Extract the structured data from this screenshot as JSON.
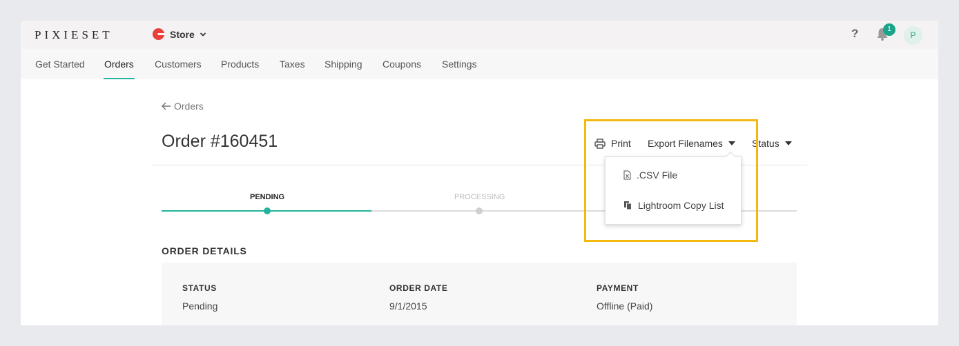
{
  "header": {
    "logo": "PIXIESET",
    "store_label": "Store",
    "help_label": "?",
    "notification_count": "1",
    "avatar_initial": "P",
    "brand_color": "#e8413c",
    "accent_color": "#2ab59a"
  },
  "nav": {
    "tabs": [
      {
        "label": "Get Started"
      },
      {
        "label": "Orders",
        "active": true
      },
      {
        "label": "Customers"
      },
      {
        "label": "Products"
      },
      {
        "label": "Taxes"
      },
      {
        "label": "Shipping"
      },
      {
        "label": "Coupons"
      },
      {
        "label": "Settings"
      }
    ]
  },
  "page": {
    "back_label": "Orders",
    "title": "Order #160451",
    "actions": {
      "print": "Print",
      "export": "Export Filenames",
      "status": "Status"
    },
    "export_menu": [
      {
        "label": ".CSV File",
        "icon": "csv-file-icon"
      },
      {
        "label": "Lightroom Copy List",
        "icon": "copy-list-icon"
      }
    ],
    "steps": [
      {
        "label": "PENDING",
        "state": "active"
      },
      {
        "label": "PROCESSING",
        "state": "upcoming"
      }
    ],
    "progress_percent": 33,
    "details": {
      "title": "ORDER DETAILS",
      "columns": [
        {
          "heading": "STATUS",
          "value": "Pending"
        },
        {
          "heading": "ORDER DATE",
          "value": "9/1/2015"
        },
        {
          "heading": "PAYMENT",
          "value": "Offline (Paid)"
        }
      ]
    },
    "highlight_color": "#f3b90f"
  }
}
